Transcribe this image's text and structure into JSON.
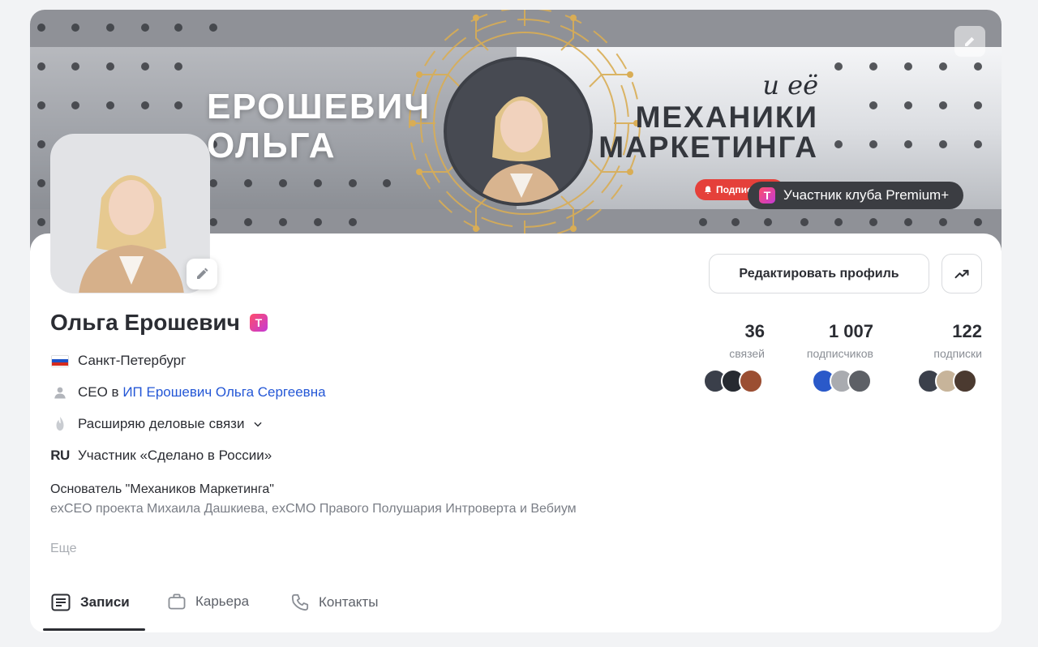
{
  "banner": {
    "name_line1": "ЕРОШЕВИЧ",
    "name_line2": "ОЛЬГА",
    "slogan_prefix": "и её",
    "slogan_line1": "МЕХАНИКИ",
    "slogan_line2": "МАРКЕТИНГА",
    "subscribe_chip": "Подписаться",
    "premium_badge": "Участник клуба Premium+"
  },
  "profile": {
    "name": "Ольга Ерошевич",
    "city": "Санкт-Петербург",
    "job_prefix": "CEO в",
    "company": "ИП Ерошевич Ольга Сергеевна",
    "goal": "Расширяю деловые связи",
    "badge_mark": "RU",
    "badge_text": "Участник «Сделано в России»",
    "about_title": "Основатель \"Механиков Маркетинга\"",
    "about_sub": "exCEO проекта Михаила Дашкиева, exCMO Правого Полушария Интроверта и Вебиум",
    "more": "Еще"
  },
  "actions": {
    "edit_profile": "Редактировать профиль"
  },
  "stats": [
    {
      "value": "36",
      "label": "связей"
    },
    {
      "value": "1 007",
      "label": "подписчиков"
    },
    {
      "value": "122",
      "label": "подписки"
    }
  ],
  "tabs": [
    {
      "label": "Записи",
      "icon": "posts-icon",
      "active": true
    },
    {
      "label": "Карьера",
      "icon": "briefcase-icon",
      "active": false
    },
    {
      "label": "Контакты",
      "icon": "phone-icon",
      "active": false
    }
  ],
  "colors": {
    "accent_link": "#2457d6",
    "text": "#2b2d33",
    "muted": "#8a8e95",
    "subscribe_red": "#e5403a",
    "premium_dark": "#3b3d42"
  }
}
